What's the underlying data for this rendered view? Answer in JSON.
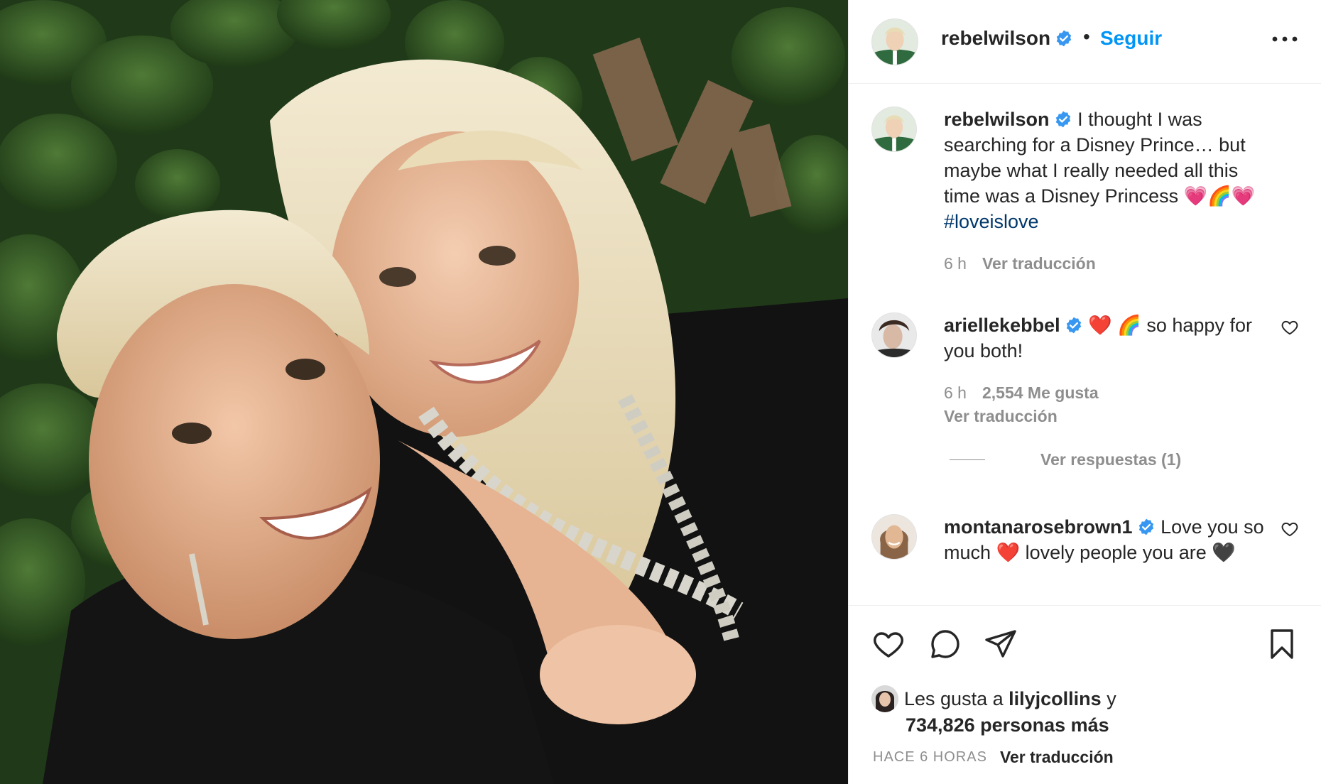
{
  "photo": {
    "alt": "post-photo"
  },
  "header": {
    "username": "rebelwilson",
    "separator": "•",
    "follow_label": "Seguir"
  },
  "caption": {
    "username": "rebelwilson",
    "text": "I thought I was searching for a Disney Prince… but maybe what I really needed all this time was a Disney Princess 💗🌈💗",
    "hashtag": "#loveislove",
    "time": "6 h",
    "translate": "Ver traducción"
  },
  "comments": [
    {
      "username": "ariellekebbel",
      "text": "❤️ 🌈 so happy for you both!",
      "time": "6 h",
      "likes": "2,554 Me gusta",
      "translate": "Ver traducción",
      "replies": "Ver respuestas (1)"
    },
    {
      "username": "montanarosebrown1",
      "text": "Love you so much ❤️ lovely people you are 🖤"
    }
  ],
  "likes": {
    "prefix": "Les gusta a",
    "user": "lilyjcollins",
    "suffix": "y",
    "others": "734,826 personas más"
  },
  "footer": {
    "time": "HACE 6 HORAS",
    "translate": "Ver traducción"
  },
  "colors": {
    "accent": "#0095f6",
    "verified": "#3897f0",
    "hashtag": "#00376b",
    "secondary": "#8e8e8e"
  }
}
